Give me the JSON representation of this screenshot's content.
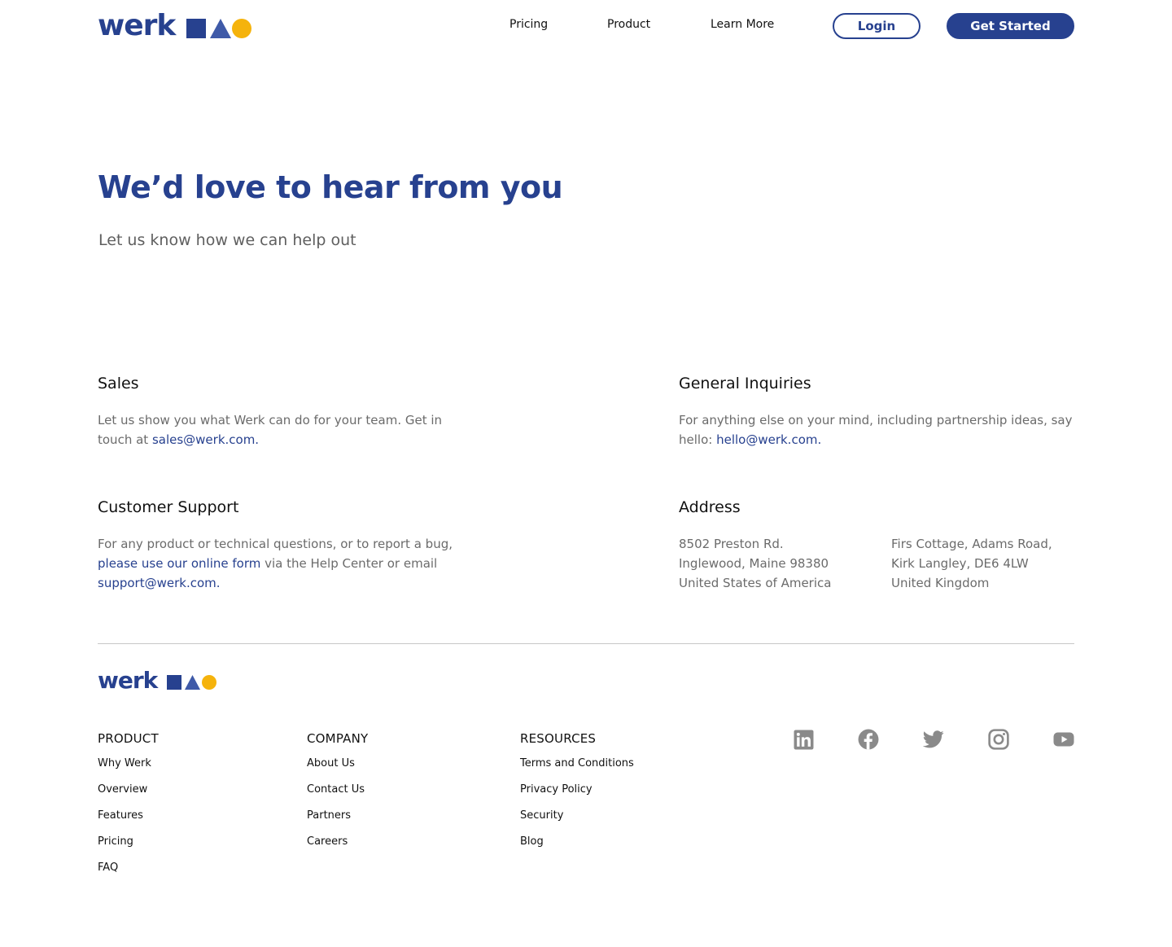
{
  "brand": {
    "name": "werk",
    "colors": {
      "primary": "#27418f",
      "triangle": "#3f5aa8",
      "accent": "#f5b30c",
      "muted_text": "#6b6b6b",
      "icon_gray": "#8a8a8a"
    },
    "shapes": [
      "square-icon",
      "triangle-icon",
      "circle-icon"
    ]
  },
  "nav": {
    "links": [
      "Pricing",
      "Product",
      "Learn More"
    ],
    "login_label": "Login",
    "get_started_label": "Get Started"
  },
  "hero": {
    "title": "We’d love to hear from you",
    "subtitle": "Let us know how we can help out"
  },
  "contact": {
    "sales": {
      "title": "Sales",
      "text_before": "Let us show you what Werk can do for your team. Get in touch at ",
      "email": "sales@werk.com.",
      "text_after": ""
    },
    "general": {
      "title": "General Inquiries",
      "text_before": "For anything else on your mind, including partnership ideas, say hello: ",
      "email": "hello@werk.com.",
      "text_after": ""
    },
    "support": {
      "title": "Customer Support",
      "text_before": "For any product or technical questions, or to report a bug, ",
      "form_link": "please use our online form",
      "text_middle": " via the Help Center or email ",
      "email": "support@werk.com."
    },
    "address": {
      "title": "Address",
      "us": [
        "8502 Preston Rd.",
        "Inglewood, Maine 98380",
        "United States of America"
      ],
      "uk": [
        "Firs Cottage, Adams Road,",
        "Kirk Langley, DE6 4LW",
        "United Kingdom"
      ]
    }
  },
  "footer": {
    "columns": [
      {
        "title": "PRODUCT",
        "items": [
          "Why Werk",
          "Overview",
          "Features",
          "Pricing",
          "FAQ"
        ]
      },
      {
        "title": "COMPANY",
        "items": [
          "About Us",
          "Contact Us",
          "Partners",
          "Careers"
        ]
      },
      {
        "title": "RESOURCES",
        "items": [
          "Terms and Conditions",
          "Privacy Policy",
          "Security",
          "Blog"
        ]
      }
    ],
    "social_icons": [
      "linkedin-icon",
      "facebook-icon",
      "twitter-icon",
      "instagram-icon",
      "youtube-icon"
    ]
  }
}
